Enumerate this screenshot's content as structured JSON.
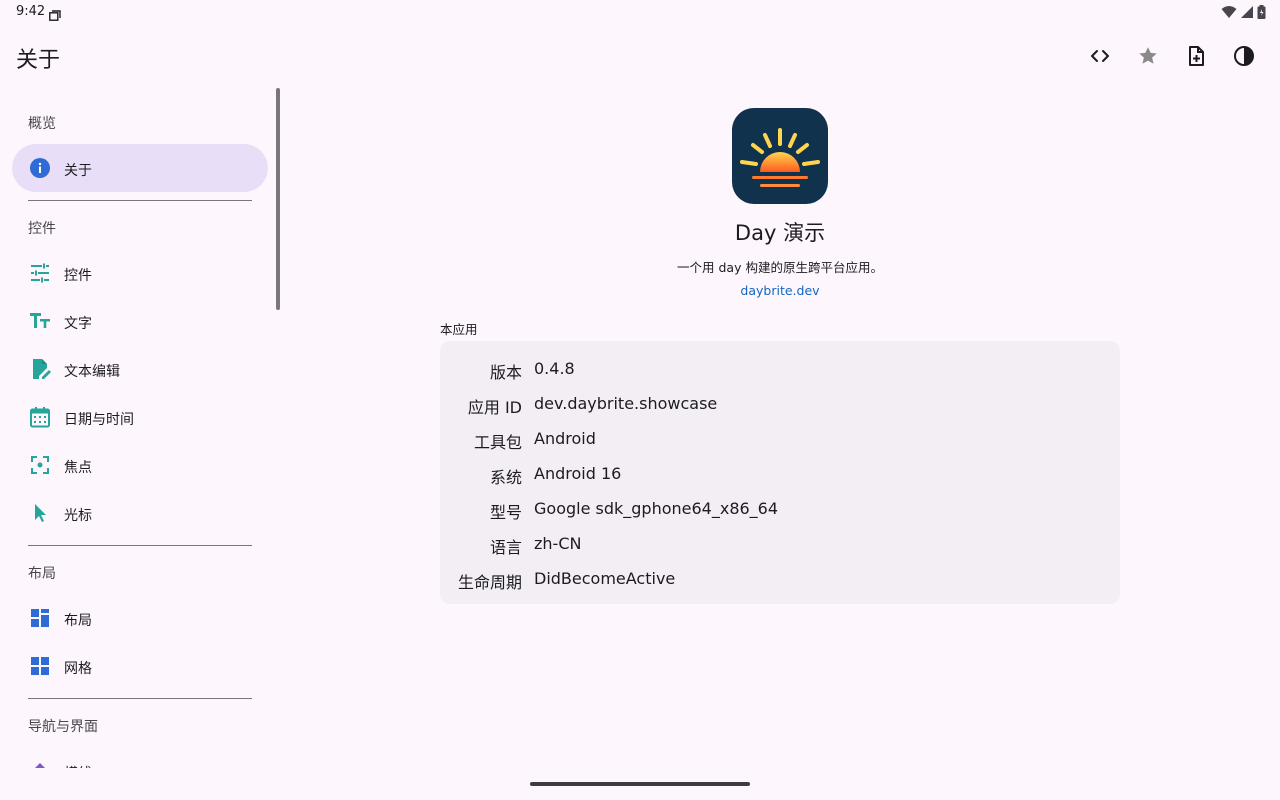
{
  "status": {
    "time": "9:42"
  },
  "appbar": {
    "title": "关于",
    "actions": [
      {
        "name": "code-icon"
      },
      {
        "name": "star-icon"
      },
      {
        "name": "note-add-icon"
      },
      {
        "name": "contrast-icon"
      }
    ]
  },
  "sidebar": {
    "sections": {
      "overview": "概览",
      "widgets": "控件",
      "layout": "布局",
      "navigation": "导航与界面"
    },
    "items": {
      "about": "关于",
      "controls": "控件",
      "text": "文字",
      "text_edit": "文本编辑",
      "datetime": "日期与时间",
      "focus": "焦点",
      "cursor": "光标",
      "layout": "布局",
      "grid": "网格",
      "partial": "横线"
    }
  },
  "app": {
    "name": "Day 演示",
    "description": "一个用 day 构建的原生跨平台应用。",
    "link": "daybrite.dev"
  },
  "info": {
    "label": "本应用",
    "rows": [
      {
        "key": "版本",
        "value": "0.4.8"
      },
      {
        "key": "应用 ID",
        "value": "dev.daybrite.showcase"
      },
      {
        "key": "工具包",
        "value": "Android"
      },
      {
        "key": "系统",
        "value": "Android 16"
      },
      {
        "key": "型号",
        "value": "Google sdk_gphone64_x86_64"
      },
      {
        "key": "语言",
        "value": "zh-CN"
      },
      {
        "key": "生命周期",
        "value": "DidBecomeActive"
      }
    ]
  },
  "colors": {
    "background": "#fdf7fd",
    "active_nav": "#e8def8",
    "icon_teal": "#26a69a",
    "icon_blue": "#1976d2",
    "link": "#1565c0",
    "card": "#f2eef4"
  }
}
